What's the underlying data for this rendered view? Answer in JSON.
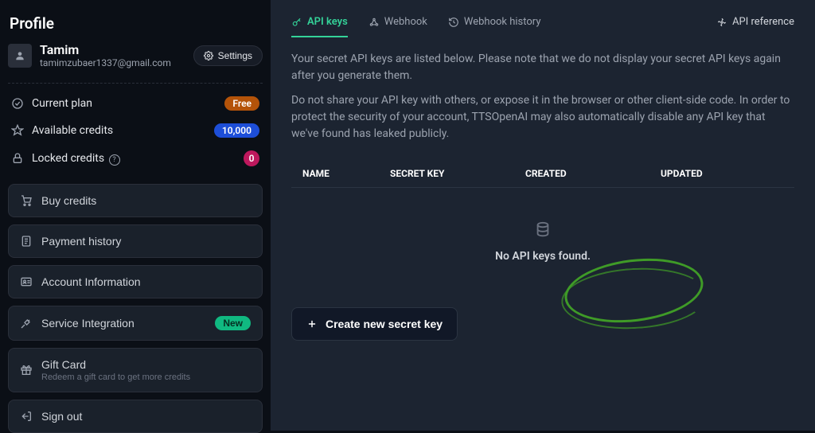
{
  "sidebar": {
    "title": "Profile",
    "user": {
      "name": "Tamim",
      "email": "tamimzubaer1337@gmail.com"
    },
    "settings_label": "Settings",
    "rows": {
      "current_plan": {
        "label": "Current plan",
        "badge": "Free"
      },
      "available_credits": {
        "label": "Available credits",
        "badge": "10,000"
      },
      "locked_credits": {
        "label": "Locked credits",
        "badge": "0"
      }
    },
    "buttons": {
      "buy_credits": "Buy credits",
      "payment_history": "Payment history",
      "account_info": "Account Information",
      "service_integration": {
        "label": "Service Integration",
        "badge": "New"
      },
      "gift_card": {
        "label": "Gift Card",
        "sub": "Redeem a gift card to get more credits"
      },
      "sign_out": "Sign out"
    }
  },
  "main": {
    "tabs": {
      "api_keys": "API keys",
      "webhook": "Webhook",
      "webhook_history": "Webhook history",
      "api_reference": "API reference"
    },
    "desc1": "Your secret API keys are listed below. Please note that we do not display your secret API keys again after you generate them.",
    "desc2": "Do not share your API key with others, or expose it in the browser or other client-side code. In order to protect the security of your account, TTSOpenAI may also automatically disable any API key that we've found has leaked publicly.",
    "table_headers": {
      "name": "NAME",
      "secret": "SECRET KEY",
      "created": "CREATED",
      "updated": "UPDATED"
    },
    "empty_text": "No API keys found.",
    "create_btn": "Create new secret key"
  }
}
